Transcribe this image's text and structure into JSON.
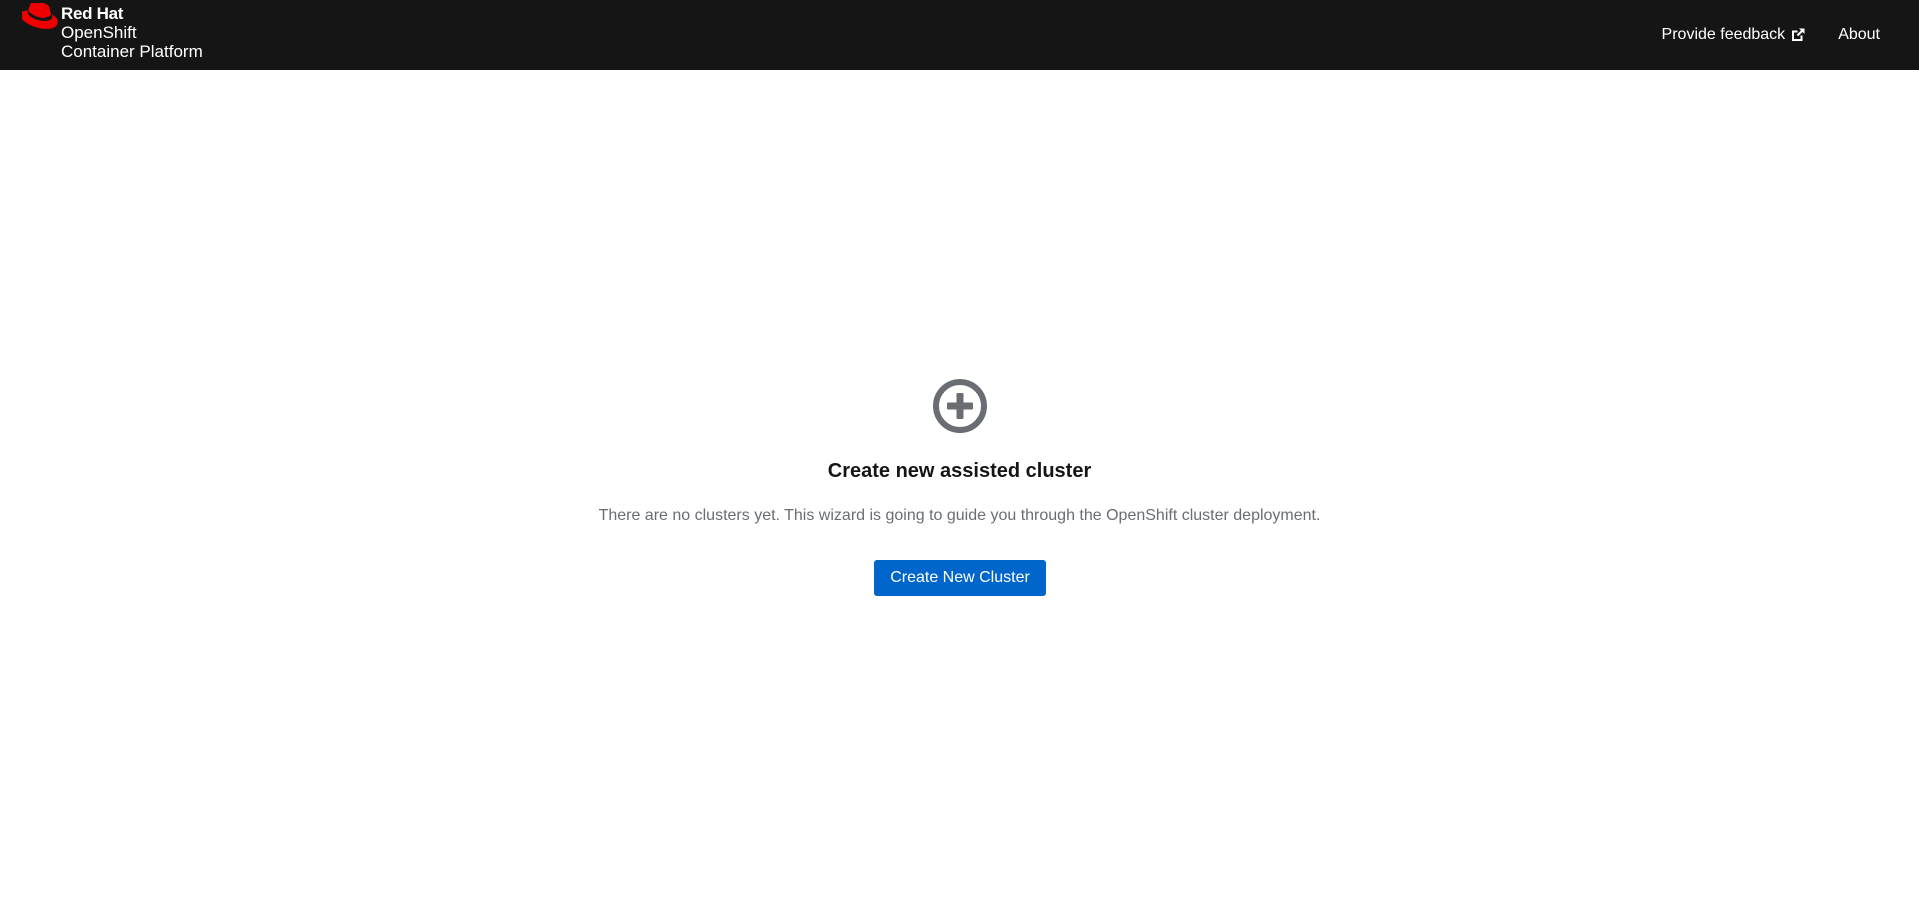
{
  "header": {
    "brand": {
      "line1": "Red Hat",
      "line2": "OpenShift",
      "line3": "Container Platform",
      "logo_icon": "red-hat-fedora-icon",
      "logo_color": "#ee0000"
    },
    "nav": {
      "feedback_label": "Provide feedback",
      "feedback_icon": "external-link-icon",
      "about_label": "About"
    },
    "background_color": "#151515"
  },
  "empty_state": {
    "icon": "plus-circle-icon",
    "icon_color": "#6a6e73",
    "title": "Create new assisted cluster",
    "body": "There are no clusters yet. This wizard is going to guide you through the OpenShift cluster deployment.",
    "primary_button_label": "Create New Cluster",
    "primary_button_color": "#0066cc"
  }
}
